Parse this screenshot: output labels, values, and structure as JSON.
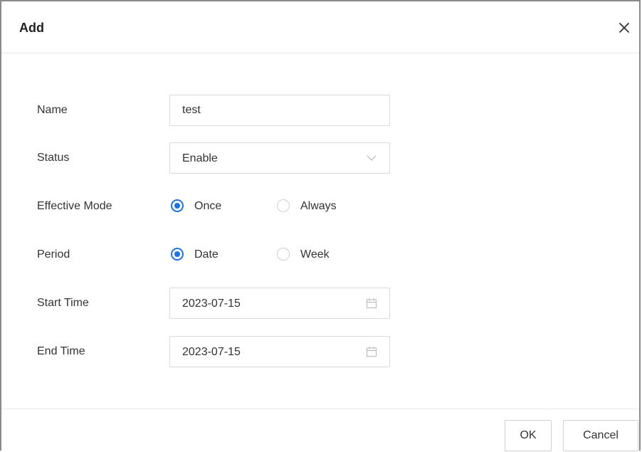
{
  "dialog": {
    "title": "Add",
    "close_icon": "close-icon"
  },
  "form": {
    "name": {
      "label": "Name",
      "value": "test"
    },
    "status": {
      "label": "Status",
      "selected": "Enable",
      "icon": "chevron-down-icon"
    },
    "effective_mode": {
      "label": "Effective Mode",
      "options": [
        {
          "label": "Once",
          "checked": true
        },
        {
          "label": "Always",
          "checked": false
        }
      ]
    },
    "period": {
      "label": "Period",
      "options": [
        {
          "label": "Date",
          "checked": true
        },
        {
          "label": "Week",
          "checked": false
        }
      ]
    },
    "start_time": {
      "label": "Start Time",
      "value": "2023-07-15",
      "icon": "calendar-icon"
    },
    "end_time": {
      "label": "End Time",
      "value": "2023-07-15",
      "icon": "calendar-icon"
    }
  },
  "footer": {
    "ok_label": "OK",
    "cancel_label": "Cancel"
  },
  "colors": {
    "accent": "#1a73e8",
    "border": "#d9d9d9",
    "text": "#333333"
  }
}
